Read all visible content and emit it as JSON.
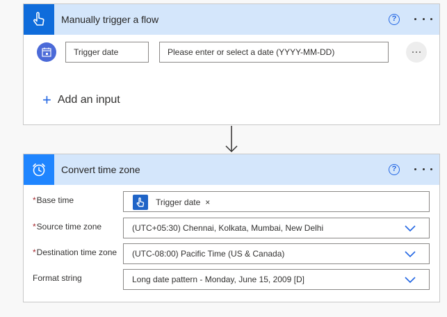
{
  "trigger_card": {
    "title": "Manually trigger a flow",
    "help_icon": "?",
    "input_name": "Trigger date",
    "input_placeholder": "Please enter or select a date (YYYY-MM-DD)",
    "add_input_label": "Add an input",
    "icons": {
      "header": "hand-pointer-icon",
      "input": "calendar-icon",
      "add": "plus-icon"
    },
    "header_color": "#0f6cdb"
  },
  "convert_card": {
    "title": "Convert time zone",
    "help_icon": "?",
    "header_color": "#1f85ff",
    "fields": [
      {
        "label": "Base time",
        "required": "*",
        "token_label": "Trigger date",
        "token_remove": "×"
      },
      {
        "label": "Source time zone",
        "required": "*",
        "value": "(UTC+05:30) Chennai, Kolkata, Mumbai, New Delhi"
      },
      {
        "label": "Destination time zone",
        "required": "*",
        "value": "(UTC-08:00) Pacific Time (US & Canada)"
      },
      {
        "label": "Format string",
        "value": "Long date pattern - Monday, June 15, 2009 [D]"
      }
    ],
    "icons": {
      "header": "alarm-clock-icon",
      "dropdown": "chevron-down-icon"
    }
  },
  "colors": {
    "accent": "#2266e3",
    "header_bg": "#d4e6fb",
    "required": "#a4262c"
  }
}
